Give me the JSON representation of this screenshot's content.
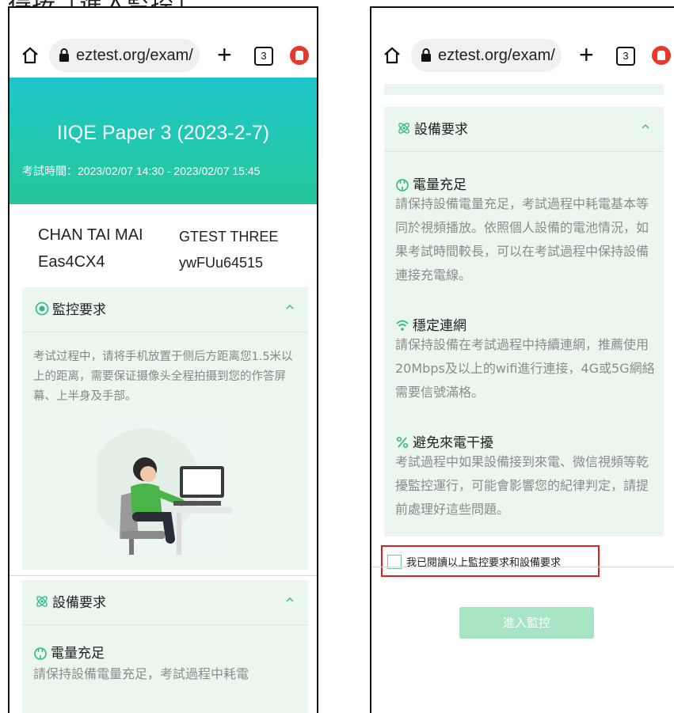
{
  "caption": "得按「進入監控」",
  "browser": {
    "url": "eztest.org/exam/",
    "tab_count": "3"
  },
  "exam": {
    "title": "IIQE Paper 3 (2023-2-7)",
    "time_label": "考試時間：",
    "time_range": "2023/02/07 14:30 - 2023/02/07 15:45"
  },
  "candidate": {
    "name": "CHAN TAI MAI",
    "code": "Eas4CX4",
    "name_alt": "GTEST THREE",
    "code_alt": "ywFUu64515"
  },
  "monitoring": {
    "title": "監控要求",
    "text": "考试过程中，请将手机放置于侧后方距离您1.5米以上的距离，需要保证摄像头全程拍摄到您的作答屏幕、上半身及手部。"
  },
  "equipment": {
    "title": "設備要求",
    "sections": [
      {
        "title": "電量充足",
        "text": "請保持設備電量充足，考試過程中耗電基本等同於視頻播放。依照個人設備的電池情況，如果考試時間較長，可以在考試過程中保持設備連接充電線。"
      },
      {
        "title": "穩定連網",
        "text": "請保持設備在考試過程中持續連網，推薦使用20Mbps及以上的wifi進行連接，4G或5G網絡需要信號滿格。"
      },
      {
        "title": "避免來電干擾",
        "text": "考試過程中如果設備接到來電、微信視頻等乾擾監控運行，可能會影響您的紀律判定，請提前處理好這些問題。"
      }
    ],
    "partial_text": "請保持設備電量充足，考試過程中耗電"
  },
  "agree_label": "我已閱讀以上監控要求和設備要求",
  "enter_button": "進入監控",
  "colors": {
    "accent": "#22c8ad",
    "card_bg": "#eaf6ee",
    "button": "#a6e4c4",
    "highlight": "#e02020"
  }
}
